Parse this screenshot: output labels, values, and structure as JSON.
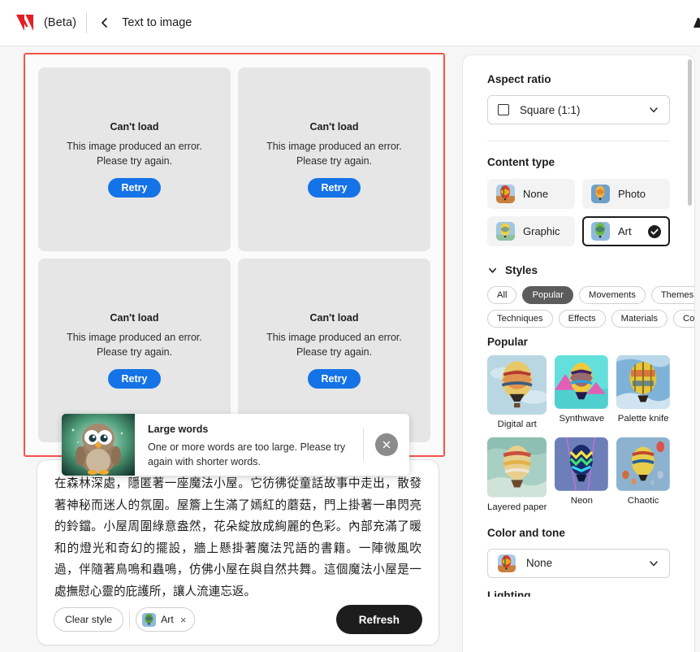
{
  "topbar": {
    "brand_icon": "adobe-logo-icon",
    "beta_label": "(Beta)",
    "back_icon": "chevron-left-icon",
    "title": "Text to image"
  },
  "results": {
    "highlight_color": "#f3534a",
    "cards": [
      {
        "title": "Can't load",
        "line1": "This image produced an error.",
        "line2": "Please try again.",
        "button": "Retry"
      },
      {
        "title": "Can't load",
        "line1": "This image produced an error.",
        "line2": "Please try again.",
        "button": "Retry"
      },
      {
        "title": "Can't load",
        "line1": "This image produced an error.",
        "line2": "Please try again.",
        "button": "Retry"
      },
      {
        "title": "Can't load",
        "line1": "This image produced an error.",
        "line2": "Please try again.",
        "button": "Retry"
      }
    ]
  },
  "toast": {
    "thumb_icon": "owl-thumbnail-image",
    "title": "Large words",
    "message": "One or more words are too large. Please try again with shorter words.",
    "close_icon": "close-icon"
  },
  "prompt": {
    "text": "在森林深處，隱匿著一座魔法小屋。它彷彿從童話故事中走出，散發著神秘而迷人的氛圍。屋簷上生滿了嫣紅的蘑菇，門上掛著一串閃亮的鈴鐺。小屋周圍綠意盎然，花朵綻放成絢麗的色彩。內部充滿了暖和的燈光和奇幻的擺設，牆上懸掛著魔法咒語的書籍。一陣微風吹過，伴隨著鳥鳴和蟲鳴，仿佛小屋在與自然共舞。這個魔法小屋是一處撫慰心靈的庇護所，讓人流連忘返。",
    "clear_style_label": "Clear style",
    "style_chip": {
      "label": "Art",
      "remove_icon": "close-x-icon",
      "thumb_icon": "art-balloon-thumb"
    },
    "refresh_label": "Refresh"
  },
  "sidebar": {
    "aspect_ratio": {
      "heading": "Aspect ratio",
      "value": "Square (1:1)",
      "icon": "square-icon",
      "chevron": "chevron-down-icon"
    },
    "content_type": {
      "heading": "Content type",
      "options": [
        {
          "label": "None",
          "selected": false,
          "thumb": "balloon-desert-thumb"
        },
        {
          "label": "Photo",
          "selected": false,
          "thumb": "balloon-photo-thumb"
        },
        {
          "label": "Graphic",
          "selected": false,
          "thumb": "balloon-graphic-thumb"
        },
        {
          "label": "Art",
          "selected": true,
          "thumb": "balloon-art-thumb",
          "check_icon": "check-circle-icon"
        }
      ]
    },
    "styles": {
      "heading": "Styles",
      "collapse_icon": "chevron-down-icon",
      "tabs_row1": [
        {
          "label": "All",
          "active": false
        },
        {
          "label": "Popular",
          "active": true
        },
        {
          "label": "Movements",
          "active": false
        },
        {
          "label": "Themes",
          "active": false
        }
      ],
      "tabs_row2": [
        {
          "label": "Techniques",
          "active": false
        },
        {
          "label": "Effects",
          "active": false
        },
        {
          "label": "Materials",
          "active": false
        },
        {
          "label": "Concepts",
          "active": false
        }
      ],
      "group_label": "Popular",
      "items": [
        {
          "label": "Digital art",
          "thumb": "digital-art-thumb"
        },
        {
          "label": "Synthwave",
          "thumb": "synthwave-thumb"
        },
        {
          "label": "Palette knife",
          "thumb": "palette-knife-thumb"
        },
        {
          "label": "Layered paper",
          "thumb": "layered-paper-thumb"
        },
        {
          "label": "Neon",
          "thumb": "neon-thumb"
        },
        {
          "label": "Chaotic",
          "thumb": "chaotic-thumb"
        }
      ]
    },
    "color_and_tone": {
      "heading": "Color and tone",
      "value": "None",
      "icon": "balloon-desert-thumb",
      "chevron": "chevron-down-icon"
    },
    "lighting": {
      "heading": "Lighting"
    }
  },
  "colors": {
    "accent_blue": "#1473e6",
    "highlight_red": "#f3534a",
    "dark_button": "#1d1d1d",
    "tag_active": "#5c5c5c"
  }
}
